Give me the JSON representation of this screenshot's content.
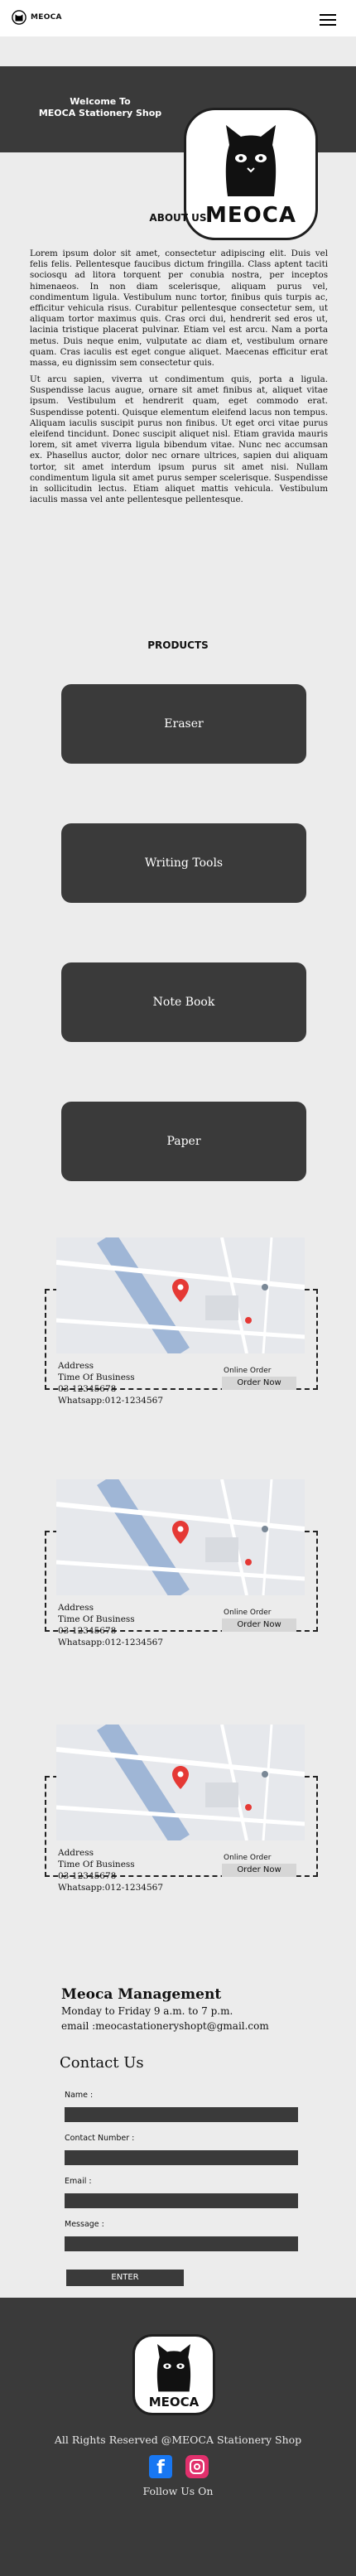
{
  "header": {
    "brand": "MEOCA",
    "menu_icon": "hamburger-menu-icon"
  },
  "hero": {
    "title_line1": "Welcome To",
    "title_line2": "MEOCA Stationery Shop",
    "logo_text": "MEOCA"
  },
  "about": {
    "heading": "ABOUT US",
    "paragraph1": "Lorem ipsum dolor sit amet, consectetur adipiscing elit. Duis vel felis felis. Pellentesque faucibus dictum fringilla. Class aptent taciti sociosqu ad litora torquent per conubia nostra, per inceptos himenaeos. In non diam scelerisque, aliquam purus vel, condimentum ligula. Vestibulum nunc tortor, finibus quis turpis ac, efficitur vehicula risus. Curabitur pellentesque consectetur sem, ut aliquam tortor maximus quis. Cras orci dui, hendrerit sed eros ut, lacinia tristique placerat pulvinar. Etiam vel est arcu. Nam a porta metus. Duis neque enim, vulputate ac diam et, vestibulum ornare quam. Cras iaculis est eget congue aliquet. Maecenas efficitur erat massa, eu dignissim sem consectetur quis.",
    "paragraph2": "Ut arcu sapien, viverra ut condimentum quis, porta a ligula. Suspendisse lacus augue, ornare sit amet finibus at, aliquet vitae ipsum. Vestibulum et hendrerit quam, eget commodo erat. Suspendisse potenti. Quisque elementum eleifend lacus non tempus. Aliquam iaculis suscipit purus non finibus. Ut eget orci vitae purus eleifend tincidunt. Donec suscipit aliquet nisl. Etiam gravida mauris lorem, sit amet viverra ligula bibendum vitae. Nunc nec accumsan ex. Phasellus auctor, dolor nec ornare ultrices, sapien dui aliquam tortor, sit amet interdum ipsum purus sit amet nisi. Nullam condimentum ligula sit amet purus semper scelerisque. Suspendisse in sollicitudin lectus. Etiam aliquet mattis vehicula. Vestibulum iaculis massa vel ante pellentesque pellentesque."
  },
  "products": {
    "heading": "PRODUCTS",
    "items": [
      {
        "label": "Eraser"
      },
      {
        "label": "Writing Tools"
      },
      {
        "label": "Note Book"
      },
      {
        "label": "Paper"
      }
    ]
  },
  "stores": [
    {
      "address": "Address",
      "time": "Time Of Business",
      "phone": "03-12345678",
      "whatsapp": "Whatsapp:012-1234567",
      "online_label": "Online Order",
      "order_label": "Order Now"
    },
    {
      "address": "Address",
      "time": "Time Of Business",
      "phone": "03-12345678",
      "whatsapp": "Whatsapp:012-1234567",
      "online_label": "Online Order",
      "order_label": "Order Now"
    },
    {
      "address": "Address",
      "time": "Time Of Business",
      "phone": "03-12345678",
      "whatsapp": "Whatsapp:012-1234567",
      "online_label": "Online Order",
      "order_label": "Order Now"
    }
  ],
  "management": {
    "title": "Meoca Management",
    "hours": "Monday to Friday 9 a.m. to 7 p.m.",
    "email": "email :meocastationeryshopt@gmail.com"
  },
  "contact": {
    "title": "Contact Us",
    "name_label": "Name :",
    "number_label": "Contact Number :",
    "email_label": "Email :",
    "message_label": "Message :",
    "submit_label": "ENTER"
  },
  "footer": {
    "logo_text": "MEOCA",
    "rights": "All Rights Reserved @MEOCA Stationery Shop",
    "follow": "Follow Us On",
    "facebook_icon": "facebook-icon",
    "instagram_icon": "instagram-icon"
  },
  "colors": {
    "dark": "#3a3a3a",
    "background": "#ececec",
    "facebook": "#1877f2",
    "instagram": "#e1306c"
  }
}
